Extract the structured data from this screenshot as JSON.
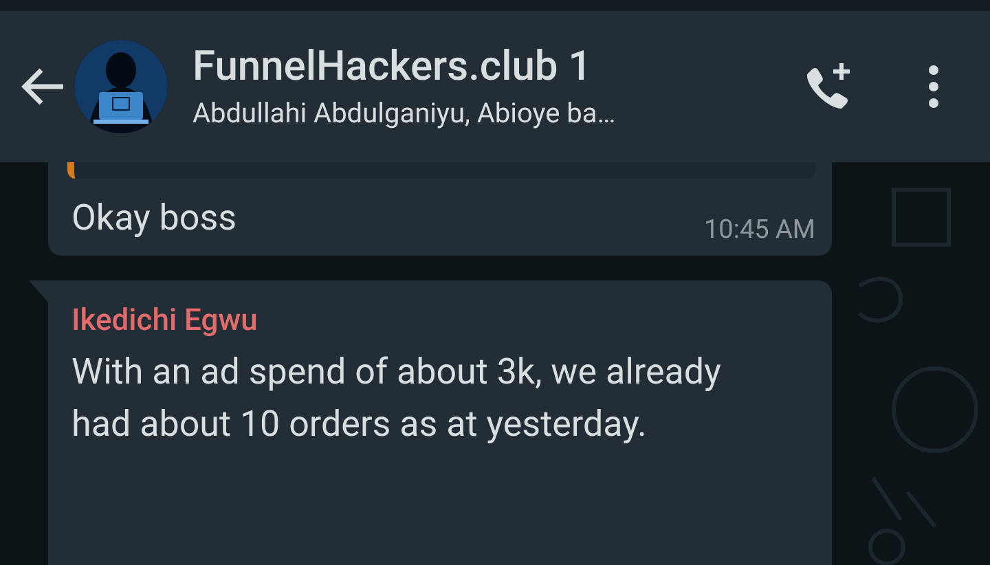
{
  "header": {
    "title": "FunnelHackers.club 1",
    "subtitle": "Abdullahi Abdulganiyu, Abioye ba…"
  },
  "messages": [
    {
      "quoted": true,
      "text": "Okay boss",
      "time": "10:45 AM",
      "tail": false
    },
    {
      "quoted": false,
      "sender": "Ikedichi Egwu",
      "color": "#e26b6b",
      "text": "With an ad spend of about 3k, we already had about 10 orders as at yesterday.",
      "tail": true
    }
  ]
}
